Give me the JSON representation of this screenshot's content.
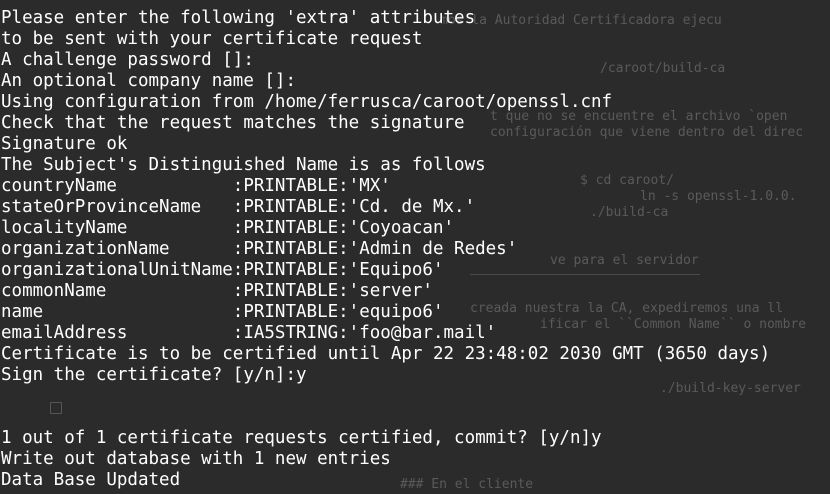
{
  "terminal": {
    "lines": [
      "Please enter the following 'extra' attributes",
      "to be sent with your certificate request",
      "A challenge password []:",
      "An optional company name []:",
      "Using configuration from /home/ferrusca/caroot/openssl.cnf",
      "Check that the request matches the signature",
      "Signature ok",
      "The Subject's Distinguished Name is as follows",
      "countryName           :PRINTABLE:'MX'",
      "stateOrProvinceName   :PRINTABLE:'Cd. de Mx.'",
      "localityName          :PRINTABLE:'Coyoacan'",
      "organizationName      :PRINTABLE:'Admin de Redes'",
      "organizationalUnitName:PRINTABLE:'Equipo6'",
      "commonName            :PRINTABLE:'server'",
      "name                  :PRINTABLE:'equipo6'",
      "emailAddress          :IA5STRING:'foo@bar.mail'",
      "Certificate is to be certified until Apr 22 23:48:02 2030 GMT (3650 days)",
      "Sign the certificate? [y/n]:y",
      "",
      "",
      "1 out of 1 certificate requests certified, commit? [y/n]y",
      "Write out database with 1 new entries",
      "Data Base Updated"
    ]
  },
  "background_doc": {
    "l1": "mos la Autoridad Certificadora ejecu",
    "l2": "/caroot/build-ca",
    "l3": "t que no se encuentre el archivo `open",
    "l4": "configuración que viene dentro del direc",
    "l5": "$ cd caroot/",
    "l6": "ln -s openssl-1.0.0.",
    "l7": "./build-ca",
    "l8": "ve para el servidor",
    "l9": "creada nuestra la CA, expediremos una ll",
    "l10": "ificar el ``Common Name`` o nombre",
    "l11": "./build-key-server",
    "l12": "### En el cliente"
  }
}
